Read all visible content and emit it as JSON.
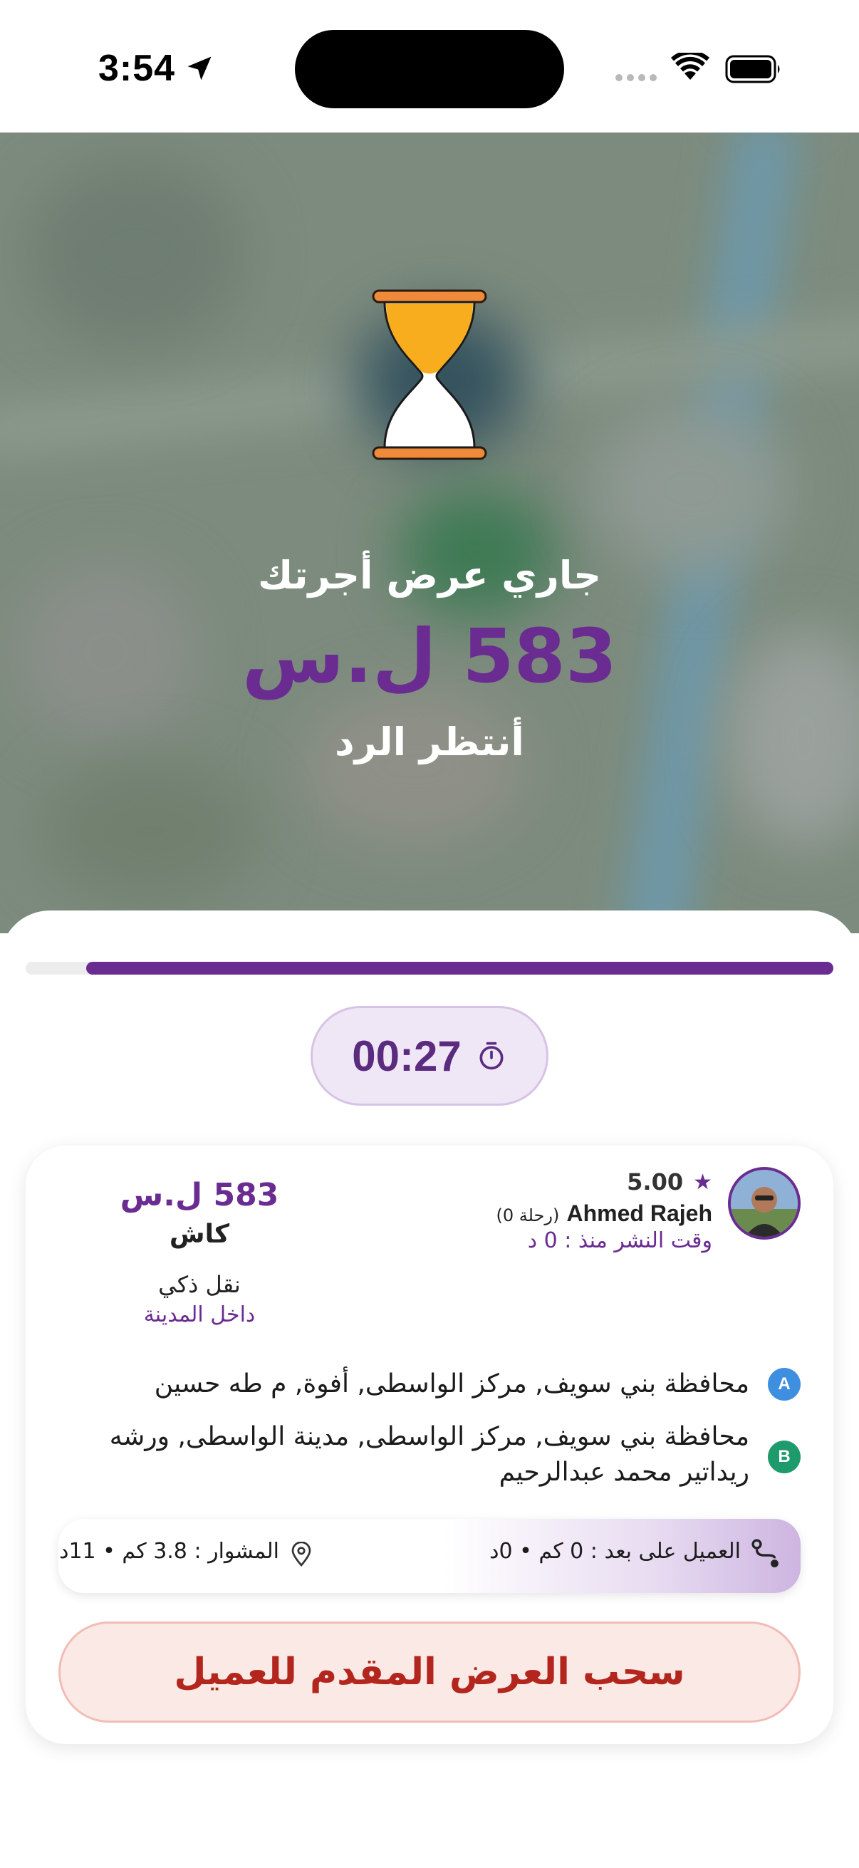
{
  "status_bar": {
    "time": "3:54"
  },
  "offer": {
    "title": "جاري عرض أجرتك",
    "price": "583 ل.س",
    "waiting": "أنتظر الرد"
  },
  "progress": {
    "fraction": 0.925
  },
  "timer": {
    "value": "00:27",
    "icon": "stopwatch-icon"
  },
  "request": {
    "rating": "5.00",
    "driver_name": "Ahmed Rajeh",
    "trips": "(0 رحلة)",
    "posted": "وقت النشر منذ : 0 د",
    "price": "583 ل.س",
    "payment": "كاش",
    "vehicle": "نقل ذكي",
    "scope": "داخل المدينة",
    "pickup_label": "A",
    "pickup": "محافظة بني سويف, مركز الواسطى, أفوة, م طه حسين",
    "dropoff_label": "B",
    "dropoff": "محافظة بني سويف, مركز الواسطى, مدينة الواسطى, ورشه ريداتير محمد عبدالرحيم",
    "client_distance": "العميل على بعد : 0 كم • 0د",
    "trip_distance": "المشوار : 3.8 كم • 11د"
  },
  "actions": {
    "withdraw": "سحب العرض المقدم للعميل"
  },
  "colors": {
    "brand": "#6a2c91",
    "danger": "#b3261e",
    "badge_a": "#3f8fe0",
    "badge_b": "#1f9a6c",
    "hourglass_sand": "#f7ad1d",
    "hourglass_caps": "#ee8a3a"
  }
}
